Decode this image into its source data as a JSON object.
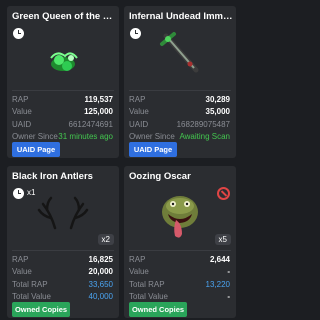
{
  "cards": [
    {
      "title": "Green Queen of the Nile",
      "rows": [
        {
          "label": "RAP",
          "value": "119,537"
        },
        {
          "label": "Value",
          "value": "125,000"
        },
        {
          "label": "UAID",
          "value": "6612474691"
        },
        {
          "label": "Owner Since",
          "value": "31 minutes ago"
        }
      ],
      "button": "UAID Page"
    },
    {
      "title": "Infernal Undead Immortal Sword",
      "rows": [
        {
          "label": "RAP",
          "value": "30,289"
        },
        {
          "label": "Value",
          "value": "35,000"
        },
        {
          "label": "UAID",
          "value": "168289075487"
        },
        {
          "label": "Owner Since",
          "value": "Awaiting Scan"
        }
      ],
      "button": "UAID Page"
    },
    {
      "title": "Black Iron Antlers",
      "multiplier": "x1",
      "count": "x2",
      "rows": [
        {
          "label": "RAP",
          "value": "16,825"
        },
        {
          "label": "Value",
          "value": "20,000"
        },
        {
          "label": "Total RAP",
          "value": "33,650"
        },
        {
          "label": "Total Value",
          "value": "40,000"
        }
      ],
      "button": "Owned Copies"
    },
    {
      "title": "Oozing Oscar",
      "count": "x5",
      "rows": [
        {
          "label": "RAP",
          "value": "2,644"
        },
        {
          "label": "Value",
          "value": "-"
        },
        {
          "label": "Total RAP",
          "value": "13,220"
        },
        {
          "label": "Total Value",
          "value": "-"
        }
      ],
      "button": "Owned Copies"
    }
  ],
  "icons": {
    "clock": "clock-icon",
    "ban": "no-trade-icon"
  },
  "colors": {
    "background": "#1c1e22",
    "card": "#2b2d31",
    "label": "#8a8d94",
    "blue_button": "#2f6fe0",
    "green_button": "#2aa55a",
    "blue_text": "#4aa3f0",
    "green_text": "#43c74f",
    "ban": "#e04545"
  }
}
